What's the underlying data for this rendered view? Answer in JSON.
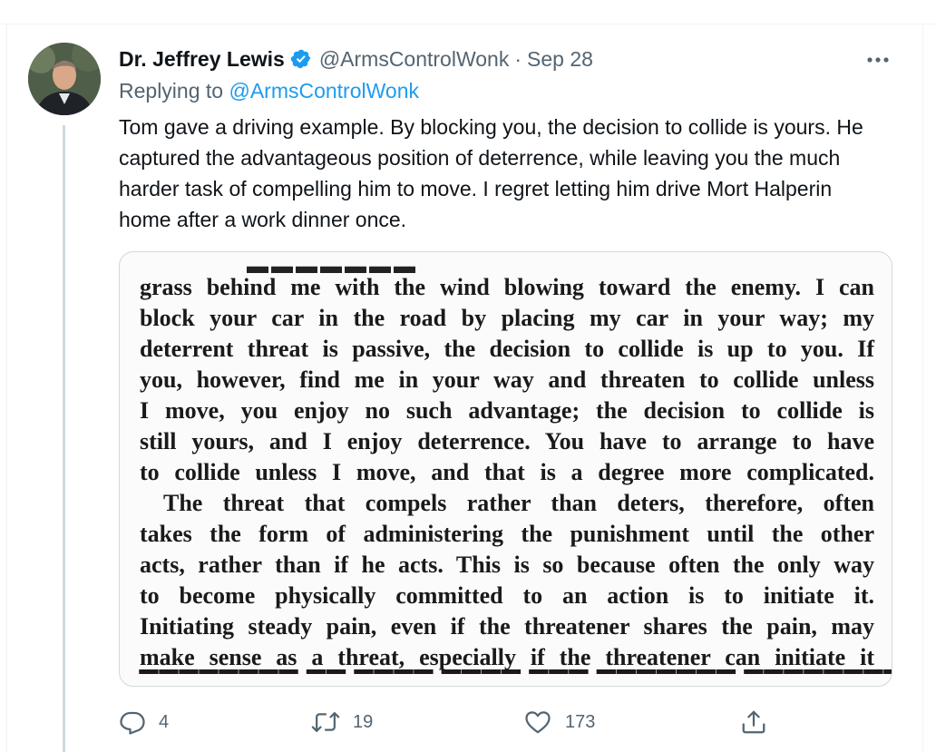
{
  "tweet": {
    "author_name": "Dr. Jeffrey Lewis",
    "handle": "@ArmsControlWonk",
    "separator": "·",
    "date": "Sep 28",
    "replying_to_prefix": "Replying to ",
    "replying_to_handle": "@ArmsControlWonk",
    "text": "Tom gave a driving example. By blocking you, the decision to collide is yours. He captured the advantageous position of deterrence, while leaving you the much harder task of compelling him to move. I regret letting him drive Mort Halperin home after a work dinner once.",
    "media": {
      "lines": [
        "grass behind me with the wind blowing toward the enemy. I can",
        "block your car in the road by placing my car in your way; my",
        "deterrent threat is passive, the decision to collide is up to you. If",
        "you, however, find me in your way and threaten to collide unless",
        "I move, you enjoy no such advantage; the decision to collide is",
        "still yours, and I enjoy deterrence. You have to arrange to have",
        "to collide unless I move, and that is a degree more complicated.",
        "The threat that compels rather than deters, therefore, often",
        "takes the form of administering the punishment until the other",
        "acts, rather than if he acts. This is so because often the only way",
        "to become physically committed to an action is to initiate it.",
        "Initiating steady pain, even if the threatener shares the pain, may",
        "make sense as a threat, especially if the threatener can initiate it"
      ]
    },
    "actions": {
      "reply_count": "4",
      "retweet_count": "19",
      "like_count": "173"
    }
  },
  "colors": {
    "accent": "#1d9bf0",
    "text": "#0f1419",
    "secondary": "#536471",
    "border": "#cfd9de"
  },
  "icons": [
    "verified-badge-icon",
    "more-icon",
    "reply-icon",
    "retweet-icon",
    "like-icon",
    "share-icon"
  ]
}
